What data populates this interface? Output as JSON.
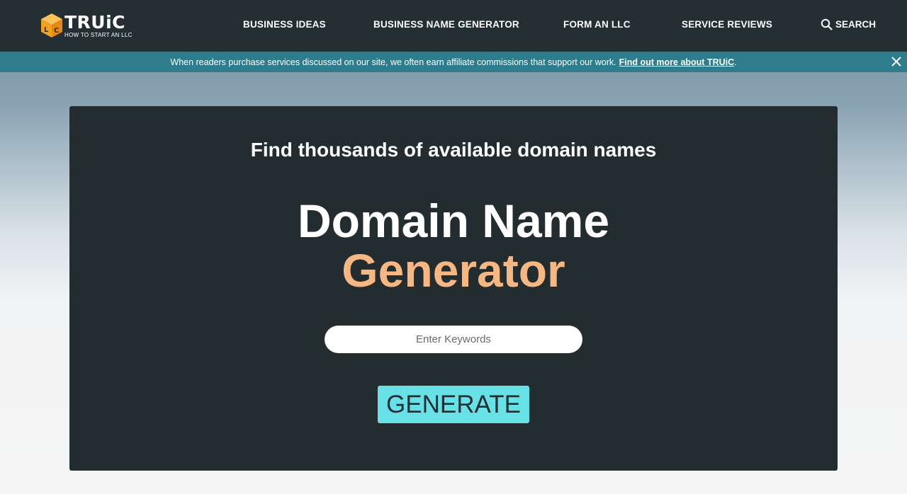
{
  "header": {
    "logo": {
      "brand": "TRUiC",
      "tagline": "HOW TO START AN LLC",
      "cube_letters": [
        "L",
        "C"
      ]
    },
    "nav": [
      {
        "label": "BUSINESS IDEAS"
      },
      {
        "label": "BUSINESS NAME GENERATOR"
      },
      {
        "label": "FORM AN LLC"
      },
      {
        "label": "SERVICE REVIEWS"
      }
    ],
    "search_label": "SEARCH"
  },
  "affiliate_banner": {
    "text": "When readers purchase services discussed on our site, we often earn affiliate commissions that support our work.",
    "link_text": "Find out more about TRUiC",
    "suffix": "."
  },
  "hero": {
    "subtitle": "Find thousands of available domain names",
    "title_line1": "Domain Name",
    "title_line2": "Generator",
    "keywords_placeholder": "Enter Keywords",
    "keywords_value": "",
    "generate_label": "GENERATE"
  },
  "colors": {
    "nav_bg": "#242f33",
    "banner_bg": "#2f7c8d",
    "hero_bg": "#232d30",
    "accent_orange": "#f6b783",
    "button_cyan": "#67e1e6",
    "logo_cube": "#f3a21f"
  },
  "icons": {
    "search": "search-icon",
    "close": "close-icon",
    "logo": "cube-logo-icon"
  }
}
